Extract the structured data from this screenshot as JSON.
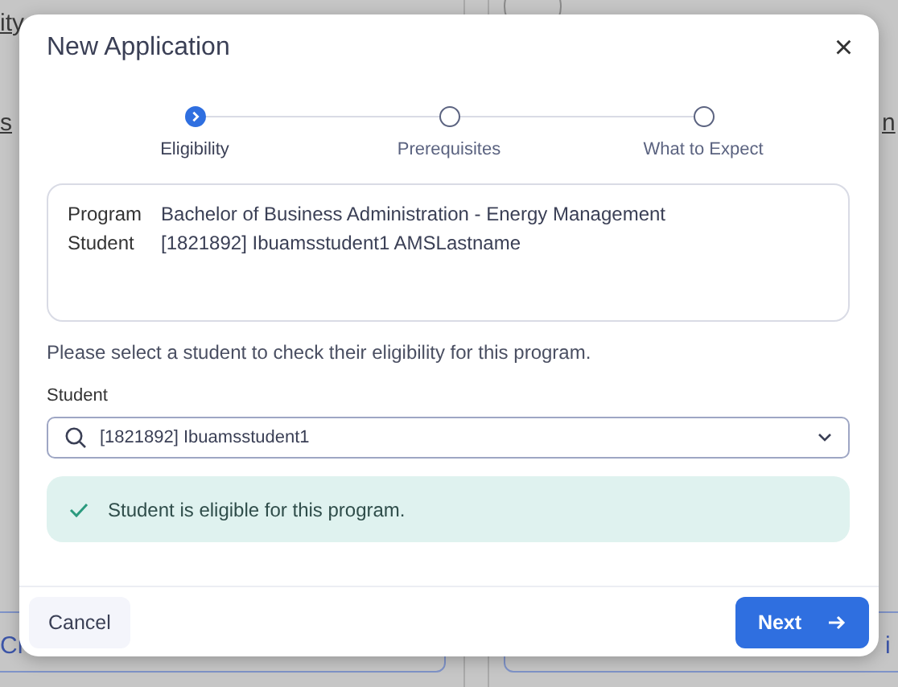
{
  "background": {
    "fragments": [
      {
        "text": "ity",
        "kind": "link"
      },
      {
        "text": "s",
        "kind": "link"
      },
      {
        "text": "n",
        "kind": "link"
      },
      {
        "text": "Cr",
        "kind": "button"
      },
      {
        "text": "i",
        "kind": "button"
      }
    ]
  },
  "dialog": {
    "title": "New Application",
    "close": "×",
    "steps": [
      {
        "label": "Eligibility",
        "selected": true
      },
      {
        "label": "Prerequisites",
        "selected": false
      },
      {
        "label": "What to Expect",
        "selected": false
      }
    ],
    "summary": [
      {
        "label": "Program",
        "value": "Bachelor of Business Administration - Energy Management"
      },
      {
        "label": "Student",
        "value": "[1821892] Ibuamsstudent1 AMSLastname"
      }
    ],
    "instruction": "Please select a student to check their eligibility for this program.",
    "student_field": {
      "label": "Student",
      "value": "[1821892] Ibuamsstudent1"
    },
    "alert": {
      "kind": "success",
      "text": "Student is eligible for this program."
    },
    "buttons": [
      {
        "label": "Cancel",
        "kind": "secondary"
      },
      {
        "label": "Next",
        "kind": "primary"
      }
    ]
  }
}
